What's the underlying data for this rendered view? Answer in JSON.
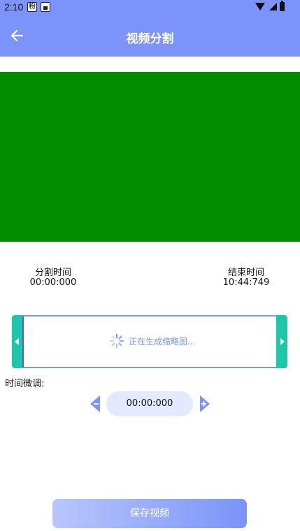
{
  "status_bar": {
    "time": "2:10",
    "notification_glyph": "粉"
  },
  "app_bar": {
    "title": "视频分割"
  },
  "times": {
    "split_label": "分割时间",
    "split_value": "00:00:000",
    "end_label": "结束时间",
    "end_value": "10:44:749"
  },
  "thumbnail_strip": {
    "loading_text": "正在生成缩略图..."
  },
  "fine_tune": {
    "label": "时间微调:",
    "value": "00:00:000"
  },
  "save_button": {
    "label": "保存视频"
  },
  "colors": {
    "primary": "#7B93FA",
    "handle": "#1DC8A8",
    "video": "#008C00",
    "timebox": "#E4E9FF"
  },
  "icons": [
    "back-arrow-icon",
    "wifi-icon",
    "signal-icon",
    "battery-icon",
    "chevron-left-icon",
    "chevron-right-icon",
    "spinner-icon",
    "minus-icon",
    "plus-icon"
  ]
}
